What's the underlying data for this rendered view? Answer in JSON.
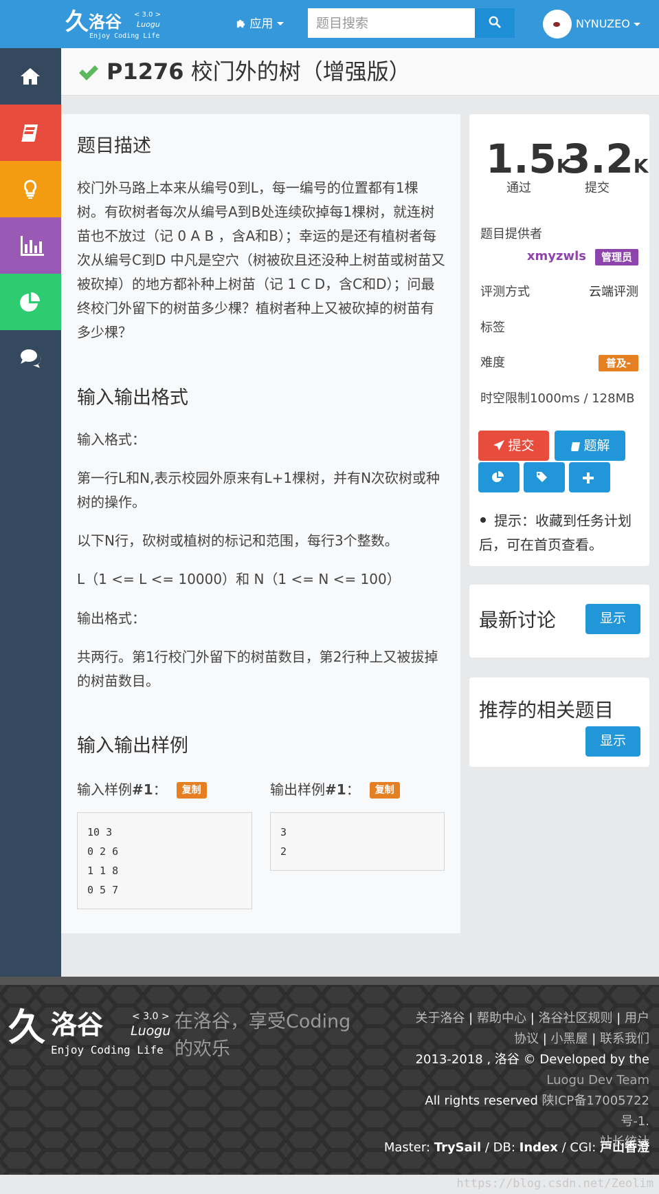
{
  "topbar": {
    "logo": {
      "glyph": "久",
      "name": "洛谷",
      "version": "< 3.0 >",
      "sub": "Luogu",
      "tagline": "Enjoy Coding Life"
    },
    "nav_app_label": "应用",
    "search": {
      "placeholder": "题目搜索"
    },
    "user": {
      "name": "NYNUZEO"
    }
  },
  "sidebar": {
    "items": [
      {
        "name": "home",
        "icon": "home-icon",
        "color": "#34495e"
      },
      {
        "name": "problems",
        "icon": "book-icon",
        "color": "#e74c3c"
      },
      {
        "name": "training",
        "icon": "lightbulb-icon",
        "color": "#f39c12"
      },
      {
        "name": "ranking",
        "icon": "bar-chart-icon",
        "color": "#9b59b6"
      },
      {
        "name": "records",
        "icon": "pie-chart-icon",
        "color": "#2ecc71"
      },
      {
        "name": "discuss",
        "icon": "comments-icon",
        "color": "#34495e"
      }
    ]
  },
  "problem": {
    "pid": "P1276",
    "title": "校门外的树（增强版）",
    "sections": {
      "desc_heading": "题目描述",
      "desc_text": "校门外马路上本来从编号0到L，每一编号的位置都有1棵树。有砍树者每次从编号A到B处连续砍掉每1棵树，就连树苗也不放过（记 0 A B ，含A和B）；幸运的是还有植树者每次从编号C到D 中凡是空穴（树被砍且还没种上树苗或树苗又被砍掉）的地方都补种上树苗（记 1 C D，含C和D）；问最终校门外留下的树苗多少棵？植树者种上又被砍掉的树苗有多少棵？",
      "io_heading": "输入输出格式",
      "input_label": "输入格式：",
      "input_line1": "第一行L和N,表示校园外原来有L+1棵树，并有N次砍树或种树的操作。",
      "input_line2": "以下N行，砍树或植树的标记和范围，每行3个整数。",
      "input_line3": "L（1 <= L <= 10000）和 N（1 <= N <= 100）",
      "output_label": "输出格式：",
      "output_line1": "共两行。第1行校门外留下的树苗数目，第2行种上又被拔掉的树苗数目。",
      "sample_heading": "输入输出样例",
      "sample_in_label": "输入样例",
      "sample_in_num": "#1",
      "sample_out_label": "输出样例",
      "sample_out_num": "#1",
      "colon": "：",
      "copy_label": "复制",
      "sample_in": "10 3\n0 2 6\n1 1 8\n0 5 7",
      "sample_out": "3\n2"
    }
  },
  "info": {
    "accepted": "1.5",
    "accepted_unit": "K",
    "accepted_label": "通过",
    "submitted": "3.2",
    "submitted_unit": "K",
    "submitted_label": "提交",
    "provider_label": "题目提供者",
    "provider_name": "xmyzwls",
    "provider_role": "管理员",
    "judge_label": "评测方式",
    "judge_value": "云端评测",
    "tags_label": "标签",
    "difficulty_label": "难度",
    "difficulty_value": "普及-",
    "limit_text": "时空限制1000ms / 128MB",
    "submit_btn": "提交",
    "solution_btn": "题解",
    "tip": "提示：收藏到任务计划后，可在首页查看。"
  },
  "discuss_card": {
    "title": "最新讨论",
    "button": "显示"
  },
  "related_card": {
    "title": "推荐的相关题目",
    "button": "显示"
  },
  "footer": {
    "logo": {
      "glyph": "久",
      "name": "洛谷",
      "version": "< 3.0 >",
      "sub": "Luogu",
      "tagline": "Enjoy Coding Life"
    },
    "slogan": "在洛谷，享受Coding的欢乐",
    "links": [
      "关于洛谷",
      "帮助中心",
      "洛谷社区规则",
      "用户协议",
      "小黑屋",
      "联系我们"
    ],
    "sep": " | ",
    "copyright_a": "2013-2018 , 洛谷 © Developed by the",
    "copyright_b": "Luogu Dev Team",
    "rights": "All rights reserved",
    "icp": "陕ICP备17005722号-1.",
    "stats": "站长统计",
    "master_label": "Master: ",
    "master": "TrySail",
    "db_label": " / DB: ",
    "db": "Index",
    "cgi_label": " / CGI: ",
    "cgi": "戸山香澄"
  },
  "watermark": "https://blog.csdn.net/Zeolim",
  "colors": {
    "brand": "#3498db",
    "success": "#5cb85c",
    "sidebar": "#34495e",
    "purple": "#8e44ad",
    "orange": "#e67e22"
  }
}
